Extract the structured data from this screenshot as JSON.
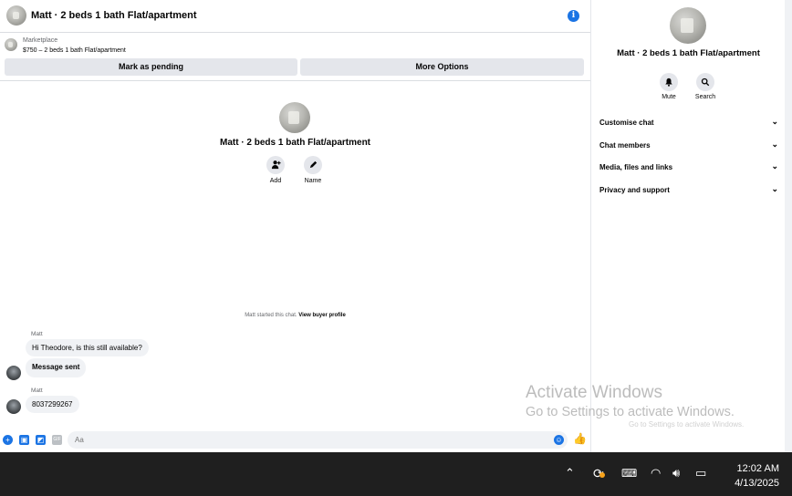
{
  "header": {
    "title": "Matt · 2 beds 1 bath Flat/apartment",
    "info_icon": "info-icon"
  },
  "marketplace": {
    "label": "Marketplace",
    "listing": "$750 – 2 beds 1 bath Flat/apartment",
    "mark_pending_label": "Mark as pending",
    "more_options_label": "More Options"
  },
  "center": {
    "title": "Matt · 2 beds 1 bath Flat/apartment",
    "add_label": "Add",
    "name_label": "Name",
    "started_text": "Matt started this chat.",
    "view_profile_link": "View buyer profile"
  },
  "messages": [
    {
      "sender": "Matt",
      "text": "Hi Theodore, is this still available?"
    },
    {
      "sender": "",
      "text": "Message sent"
    },
    {
      "sender": "Matt",
      "text": "8037299267"
    }
  ],
  "composer": {
    "placeholder": "Aa"
  },
  "side": {
    "title": "Matt · 2 beds 1 bath Flat/apartment",
    "mute_label": "Mute",
    "search_label": "Search",
    "sections": [
      "Customise chat",
      "Chat members",
      "Media, files and links",
      "Privacy and support"
    ]
  },
  "watermark": {
    "line1": "Activate Windows",
    "line2": "Go to Settings to activate Windows.",
    "line3": "Go to Settings to activate Windows."
  },
  "taskbar": {
    "time": "12:02 AM",
    "date": "4/13/2025"
  },
  "colors": {
    "accent": "#1b74e4",
    "button_bg": "#e4e6eb",
    "taskbar_bg": "#1f1f1f"
  }
}
